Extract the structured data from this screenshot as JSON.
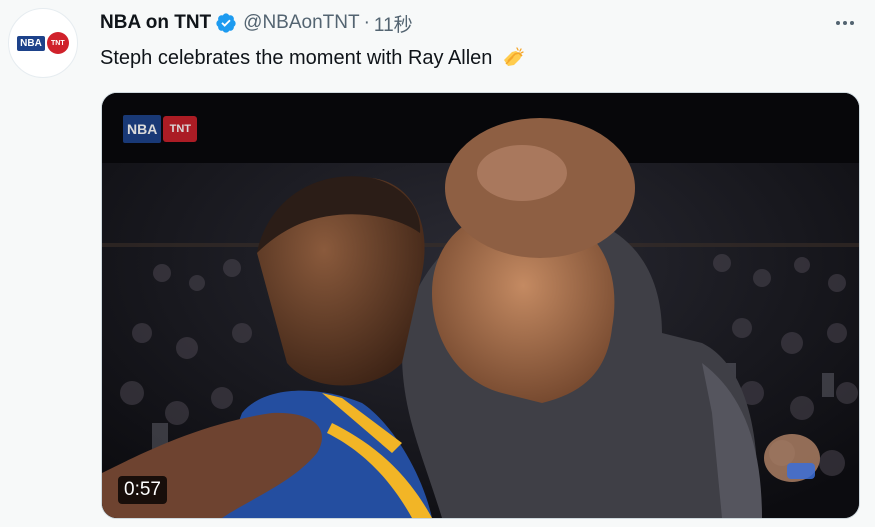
{
  "tweet": {
    "display_name": "NBA on TNT",
    "handle": "@NBAonTNT",
    "separator": "·",
    "time": "11秒",
    "text": "Steph celebrates the moment with Ray Allen",
    "avatar": {
      "logo_nba": "NBA",
      "logo_tnt": "TNT"
    },
    "icons": [
      "verified-badge-icon",
      "more-options-icon",
      "clap-emoji-icon"
    ],
    "accent_color": "#1d9bf0"
  },
  "media": {
    "type": "video",
    "duration": "0:57",
    "broadcast_bug": {
      "nba": "NBA",
      "tnt": "TNT"
    }
  }
}
